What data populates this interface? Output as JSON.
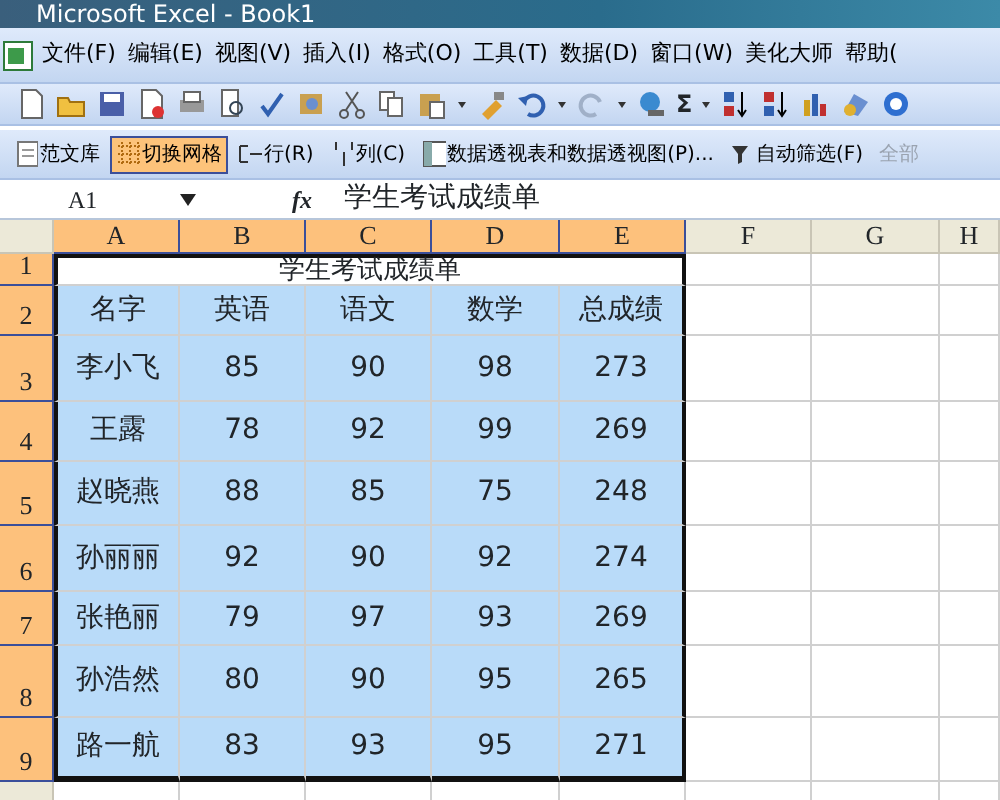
{
  "window": {
    "title": "Microsoft Excel - Book1"
  },
  "menu": [
    {
      "label": "文件(F)"
    },
    {
      "label": "编辑(E)"
    },
    {
      "label": "视图(V)"
    },
    {
      "label": "插入(I)"
    },
    {
      "label": "格式(O)"
    },
    {
      "label": "工具(T)"
    },
    {
      "label": "数据(D)"
    },
    {
      "label": "窗口(W)"
    },
    {
      "label": "美化大师"
    },
    {
      "label": "帮助("
    }
  ],
  "standard_toolbar": {
    "sum_symbol": "Σ"
  },
  "custom_toolbar": [
    {
      "label": "范文库",
      "kind": "template",
      "selected": false,
      "disabled": false
    },
    {
      "label": "切换网格",
      "kind": "grid",
      "selected": true,
      "disabled": false
    },
    {
      "label": "行(R)",
      "kind": "row",
      "selected": false,
      "disabled": false
    },
    {
      "label": "列(C)",
      "kind": "column",
      "selected": false,
      "disabled": false
    },
    {
      "label": "数据透视表和数据透视图(P)...",
      "kind": "pivot",
      "selected": false,
      "disabled": false
    },
    {
      "label": "自动筛选(F)",
      "kind": "filter",
      "selected": false,
      "disabled": false
    },
    {
      "label": "全部",
      "kind": "plain",
      "selected": false,
      "disabled": true
    }
  ],
  "formula_bar": {
    "name_box": "A1",
    "function_label": "fx",
    "value": "学生考试成绩单"
  },
  "columns": [
    {
      "label": "A",
      "selected": true
    },
    {
      "label": "B",
      "selected": true
    },
    {
      "label": "C",
      "selected": true
    },
    {
      "label": "D",
      "selected": true
    },
    {
      "label": "E",
      "selected": true
    },
    {
      "label": "F",
      "selected": false
    },
    {
      "label": "G",
      "selected": false
    },
    {
      "label": "H",
      "selected": false
    }
  ],
  "rows": [
    {
      "label": "1",
      "selected": true,
      "kind": "merged",
      "highlighted": false,
      "cells": [
        "学生考试成绩单"
      ]
    },
    {
      "label": "2",
      "selected": true,
      "kind": "data",
      "highlighted": true,
      "cells": [
        "名字",
        "英语",
        "语文",
        "数学",
        "总成绩"
      ]
    },
    {
      "label": "3",
      "selected": true,
      "kind": "data",
      "highlighted": true,
      "cells": [
        "李小飞",
        "85",
        "90",
        "98",
        "273"
      ]
    },
    {
      "label": "4",
      "selected": true,
      "kind": "data",
      "highlighted": true,
      "cells": [
        "王露",
        "78",
        "92",
        "99",
        "269"
      ]
    },
    {
      "label": "5",
      "selected": true,
      "kind": "data",
      "highlighted": true,
      "cells": [
        "赵晓燕",
        "88",
        "85",
        "75",
        "248"
      ]
    },
    {
      "label": "6",
      "selected": true,
      "kind": "data",
      "highlighted": true,
      "cells": [
        "孙丽丽",
        "92",
        "90",
        "92",
        "274"
      ]
    },
    {
      "label": "7",
      "selected": true,
      "kind": "data",
      "highlighted": true,
      "cells": [
        "张艳丽",
        "79",
        "97",
        "93",
        "269"
      ]
    },
    {
      "label": "8",
      "selected": true,
      "kind": "data",
      "highlighted": true,
      "cells": [
        "孙浩然",
        "80",
        "90",
        "95",
        "265"
      ]
    },
    {
      "label": "9",
      "selected": true,
      "kind": "data",
      "highlighted": true,
      "cells": [
        "路一航",
        "83",
        "93",
        "95",
        "271"
      ]
    }
  ]
}
